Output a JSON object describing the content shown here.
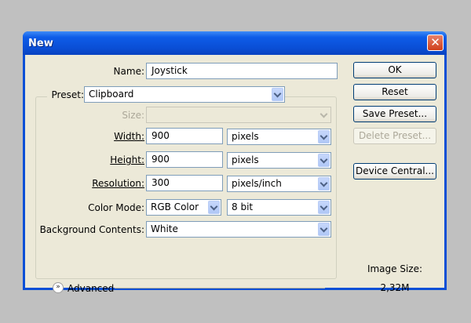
{
  "dialog": {
    "title": "New",
    "close_glyph": "✕"
  },
  "name": {
    "label": "Name:",
    "value": "Joystick"
  },
  "preset": {
    "label": "Preset:",
    "value": "Clipboard"
  },
  "size": {
    "label": "Size:",
    "value": ""
  },
  "width": {
    "label": "Width:",
    "value": "900",
    "unit": "pixels"
  },
  "height": {
    "label": "Height:",
    "value": "900",
    "unit": "pixels"
  },
  "resolution": {
    "label": "Resolution:",
    "value": "300",
    "unit": "pixels/inch"
  },
  "color_mode": {
    "label": "Color Mode:",
    "value": "RGB Color",
    "depth": "8 bit"
  },
  "background_contents": {
    "label": "Background Contents:",
    "value": "White"
  },
  "advanced": {
    "label": "Advanced",
    "icon": "double-chevron-down-icon"
  },
  "buttons": {
    "ok": "OK",
    "reset": "Reset",
    "save_preset": "Save Preset...",
    "delete_preset": "Delete Preset...",
    "device_central": "Device Central..."
  },
  "image_size": {
    "label": "Image Size:",
    "value": "2,32M"
  },
  "colors": {
    "titlebar": "#0a4fd6",
    "client_bg": "#ece9d8",
    "desktop_bg": "#c0c0c0"
  }
}
